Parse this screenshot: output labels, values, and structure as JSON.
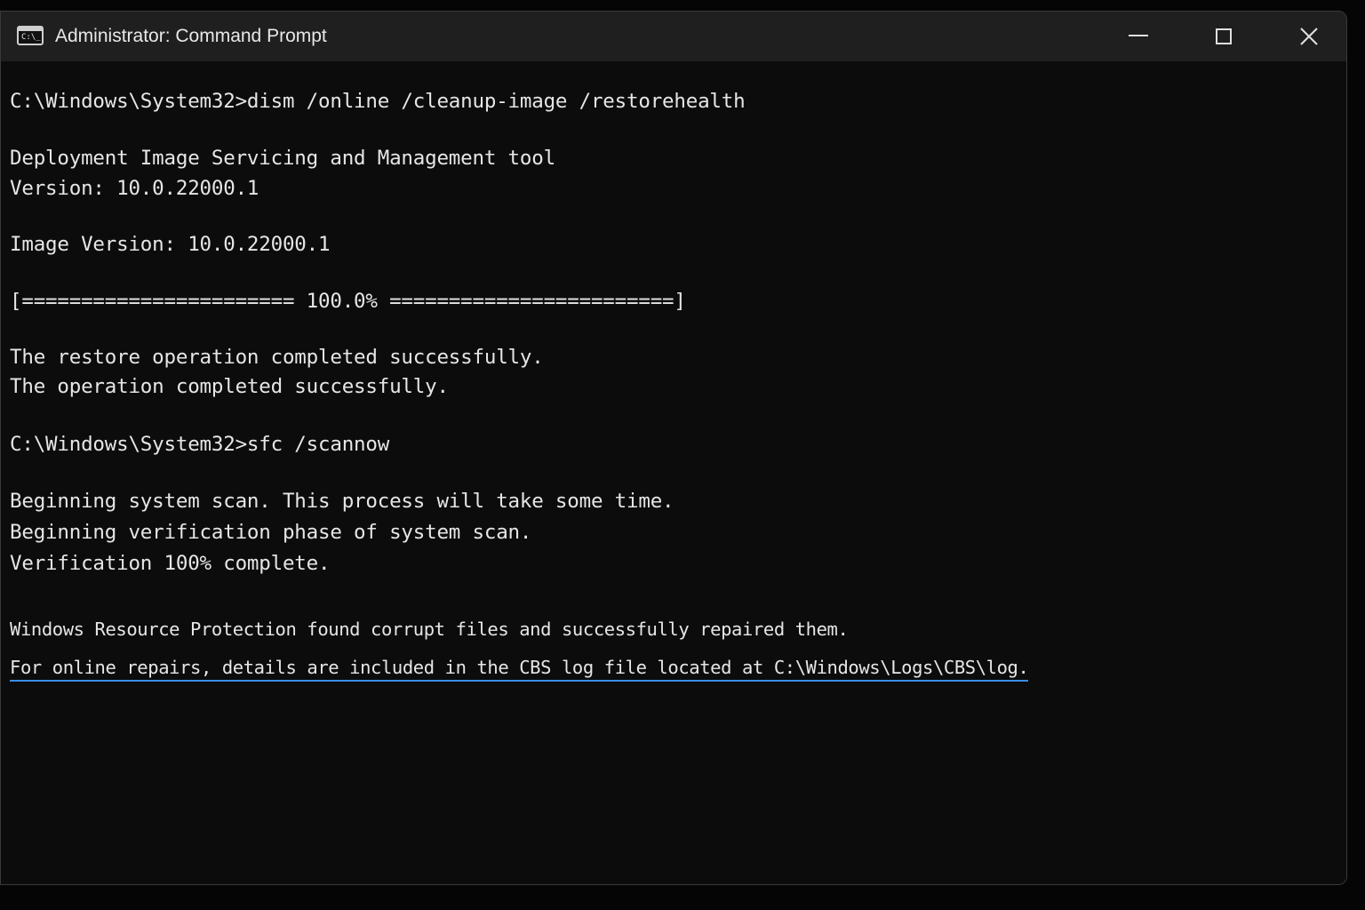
{
  "window": {
    "title": "Administrator: Command Prompt",
    "icon": "cmd-prompt-icon",
    "icon_glyph": "C:\\_",
    "controls": {
      "minimize": "minimize-icon",
      "maximize": "maximize-icon",
      "close": "close-icon"
    }
  },
  "colors": {
    "background": "#0c0c0c",
    "titlebar": "#1f1f1f",
    "text": "#e6e6e6",
    "link_underline": "#3b8eea"
  },
  "console": {
    "lines": [
      "C:\\Windows\\System32>dism /online /cleanup-image /restorehealth",
      "Deployment Image Servicing and Management tool",
      "Version: 10.0.22000.1",
      "Image Version: 10.0.22000.1",
      "[======================= 100.0% ========================]",
      "The restore operation completed successfully.",
      "The operation completed successfully.",
      "C:\\Windows\\System32>sfc /scannow",
      "Beginning system scan. This process will take some time.",
      "Beginning verification phase of system scan.",
      "Verification 100% complete.",
      "Windows Resource Protection found corrupt files and successfully repaired them.",
      "For online repairs, details are included in the CBS log file located at C:\\Windows\\Logs\\CBS\\log."
    ]
  }
}
